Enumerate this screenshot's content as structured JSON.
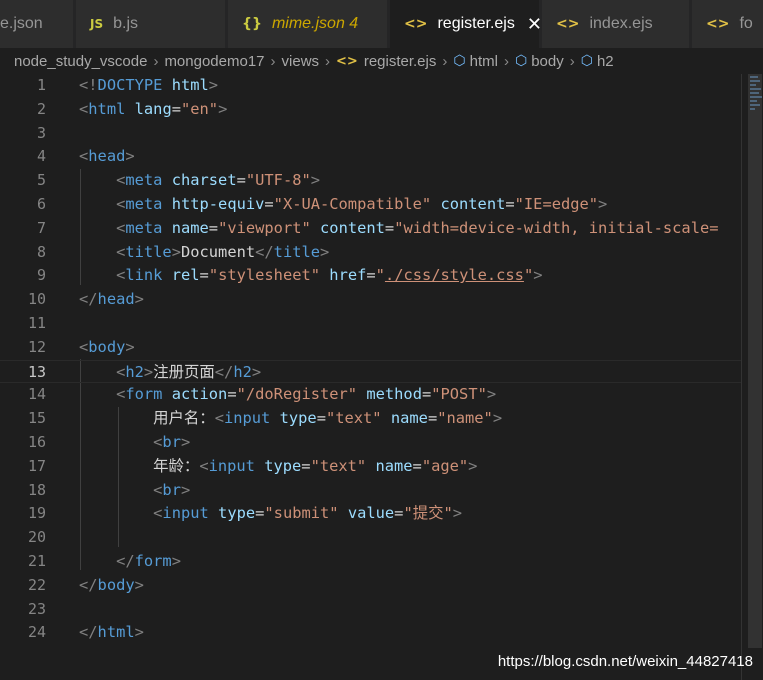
{
  "tabs": [
    {
      "label": "e.json",
      "icon": "json-braces-icon",
      "active": false
    },
    {
      "label": "b.js",
      "icon": "js-icon",
      "active": false
    },
    {
      "label": "mime.json 4",
      "icon": "json-braces-icon",
      "active": false,
      "modified": true
    },
    {
      "label": "register.ejs",
      "icon": "ejs-icon",
      "active": true
    },
    {
      "label": "index.ejs",
      "icon": "ejs-icon",
      "active": false
    },
    {
      "label": "fo",
      "icon": "ejs-icon",
      "active": false
    }
  ],
  "breadcrumb": [
    "node_study_vscode",
    "mongodemo17",
    "views",
    "register.ejs",
    "html",
    "body",
    "h2"
  ],
  "editor": {
    "current_line": 13,
    "lines": [
      {
        "n": "1",
        "tokens": [
          [
            "br",
            "<!"
          ],
          [
            "tag",
            "DOCTYPE"
          ],
          [
            "txt",
            " "
          ],
          [
            "attr",
            "html"
          ],
          [
            "br",
            ">"
          ]
        ]
      },
      {
        "n": "2",
        "tokens": [
          [
            "br",
            "<"
          ],
          [
            "tag",
            "html"
          ],
          [
            "txt",
            " "
          ],
          [
            "attr",
            "lang"
          ],
          [
            "txt",
            "="
          ],
          [
            "str",
            "\"en\""
          ],
          [
            "br",
            ">"
          ]
        ]
      },
      {
        "n": "3",
        "tokens": []
      },
      {
        "n": "4",
        "tokens": [
          [
            "br",
            "<"
          ],
          [
            "tag",
            "head"
          ],
          [
            "br",
            ">"
          ]
        ]
      },
      {
        "n": "5",
        "tokens": [
          [
            "txt",
            "    "
          ],
          [
            "br",
            "<"
          ],
          [
            "tag",
            "meta"
          ],
          [
            "txt",
            " "
          ],
          [
            "attr",
            "charset"
          ],
          [
            "txt",
            "="
          ],
          [
            "str",
            "\"UTF-8\""
          ],
          [
            "br",
            ">"
          ]
        ]
      },
      {
        "n": "6",
        "tokens": [
          [
            "txt",
            "    "
          ],
          [
            "br",
            "<"
          ],
          [
            "tag",
            "meta"
          ],
          [
            "txt",
            " "
          ],
          [
            "attr",
            "http-equiv"
          ],
          [
            "txt",
            "="
          ],
          [
            "str",
            "\"X-UA-Compatible\""
          ],
          [
            "txt",
            " "
          ],
          [
            "attr",
            "content"
          ],
          [
            "txt",
            "="
          ],
          [
            "str",
            "\"IE=edge\""
          ],
          [
            "br",
            ">"
          ]
        ]
      },
      {
        "n": "7",
        "tokens": [
          [
            "txt",
            "    "
          ],
          [
            "br",
            "<"
          ],
          [
            "tag",
            "meta"
          ],
          [
            "txt",
            " "
          ],
          [
            "attr",
            "name"
          ],
          [
            "txt",
            "="
          ],
          [
            "str",
            "\"viewport\""
          ],
          [
            "txt",
            " "
          ],
          [
            "attr",
            "content"
          ],
          [
            "txt",
            "="
          ],
          [
            "str",
            "\"width=device-width, initial-scale="
          ]
        ]
      },
      {
        "n": "8",
        "tokens": [
          [
            "txt",
            "    "
          ],
          [
            "br",
            "<"
          ],
          [
            "tag",
            "title"
          ],
          [
            "br",
            ">"
          ],
          [
            "txt",
            "Document"
          ],
          [
            "br",
            "</"
          ],
          [
            "tag",
            "title"
          ],
          [
            "br",
            ">"
          ]
        ]
      },
      {
        "n": "9",
        "tokens": [
          [
            "txt",
            "    "
          ],
          [
            "br",
            "<"
          ],
          [
            "tag",
            "link"
          ],
          [
            "txt",
            " "
          ],
          [
            "attr",
            "rel"
          ],
          [
            "txt",
            "="
          ],
          [
            "str",
            "\"stylesheet\""
          ],
          [
            "txt",
            " "
          ],
          [
            "attr",
            "href"
          ],
          [
            "txt",
            "="
          ],
          [
            "str",
            "\""
          ],
          [
            "link",
            "./css/style.css"
          ],
          [
            "str",
            "\""
          ],
          [
            "br",
            ">"
          ]
        ]
      },
      {
        "n": "10",
        "tokens": [
          [
            "br",
            "</"
          ],
          [
            "tag",
            "head"
          ],
          [
            "br",
            ">"
          ]
        ]
      },
      {
        "n": "11",
        "tokens": []
      },
      {
        "n": "12",
        "tokens": [
          [
            "br",
            "<"
          ],
          [
            "tag",
            "body"
          ],
          [
            "br",
            ">"
          ]
        ]
      },
      {
        "n": "13",
        "tokens": [
          [
            "txt",
            "    "
          ],
          [
            "br",
            "<"
          ],
          [
            "tag",
            "h2"
          ],
          [
            "br",
            ">"
          ],
          [
            "txt",
            "注册页面"
          ],
          [
            "br",
            "</"
          ],
          [
            "tag",
            "h2"
          ],
          [
            "br",
            ">"
          ]
        ]
      },
      {
        "n": "14",
        "tokens": [
          [
            "txt",
            "    "
          ],
          [
            "br",
            "<"
          ],
          [
            "tag",
            "form"
          ],
          [
            "txt",
            " "
          ],
          [
            "attr",
            "action"
          ],
          [
            "txt",
            "="
          ],
          [
            "str",
            "\"/doRegister\""
          ],
          [
            "txt",
            " "
          ],
          [
            "attr",
            "method"
          ],
          [
            "txt",
            "="
          ],
          [
            "str",
            "\"POST\""
          ],
          [
            "br",
            ">"
          ]
        ]
      },
      {
        "n": "15",
        "tokens": [
          [
            "txt",
            "        用户名："
          ],
          [
            "br",
            "<"
          ],
          [
            "tag",
            "input"
          ],
          [
            "txt",
            " "
          ],
          [
            "attr",
            "type"
          ],
          [
            "txt",
            "="
          ],
          [
            "str",
            "\"text\""
          ],
          [
            "txt",
            " "
          ],
          [
            "attr",
            "name"
          ],
          [
            "txt",
            "="
          ],
          [
            "str",
            "\"name\""
          ],
          [
            "br",
            ">"
          ]
        ]
      },
      {
        "n": "16",
        "tokens": [
          [
            "txt",
            "        "
          ],
          [
            "br",
            "<"
          ],
          [
            "tag",
            "br"
          ],
          [
            "br",
            ">"
          ]
        ]
      },
      {
        "n": "17",
        "tokens": [
          [
            "txt",
            "        年龄："
          ],
          [
            "br",
            "<"
          ],
          [
            "tag",
            "input"
          ],
          [
            "txt",
            " "
          ],
          [
            "attr",
            "type"
          ],
          [
            "txt",
            "="
          ],
          [
            "str",
            "\"text\""
          ],
          [
            "txt",
            " "
          ],
          [
            "attr",
            "name"
          ],
          [
            "txt",
            "="
          ],
          [
            "str",
            "\"age\""
          ],
          [
            "br",
            ">"
          ]
        ]
      },
      {
        "n": "18",
        "tokens": [
          [
            "txt",
            "        "
          ],
          [
            "br",
            "<"
          ],
          [
            "tag",
            "br"
          ],
          [
            "br",
            ">"
          ]
        ]
      },
      {
        "n": "19",
        "tokens": [
          [
            "txt",
            "        "
          ],
          [
            "br",
            "<"
          ],
          [
            "tag",
            "input"
          ],
          [
            "txt",
            " "
          ],
          [
            "attr",
            "type"
          ],
          [
            "txt",
            "="
          ],
          [
            "str",
            "\"submit\""
          ],
          [
            "txt",
            " "
          ],
          [
            "attr",
            "value"
          ],
          [
            "txt",
            "="
          ],
          [
            "str",
            "\"提交\""
          ],
          [
            "br",
            ">"
          ]
        ]
      },
      {
        "n": "20",
        "tokens": []
      },
      {
        "n": "21",
        "tokens": [
          [
            "txt",
            "    "
          ],
          [
            "br",
            "</"
          ],
          [
            "tag",
            "form"
          ],
          [
            "br",
            ">"
          ]
        ]
      },
      {
        "n": "22",
        "tokens": [
          [
            "br",
            "</"
          ],
          [
            "tag",
            "body"
          ],
          [
            "br",
            ">"
          ]
        ]
      },
      {
        "n": "23",
        "tokens": []
      },
      {
        "n": "24",
        "tokens": [
          [
            "br",
            "</"
          ],
          [
            "tag",
            "html"
          ],
          [
            "br",
            ">"
          ]
        ]
      }
    ]
  },
  "watermark": "https://blog.csdn.net/weixin_44827418",
  "colors": {
    "background": "#1e1e1e",
    "tag": "#569cd6",
    "attribute": "#9cdcfe",
    "string": "#ce9178",
    "bracket": "#808080"
  }
}
